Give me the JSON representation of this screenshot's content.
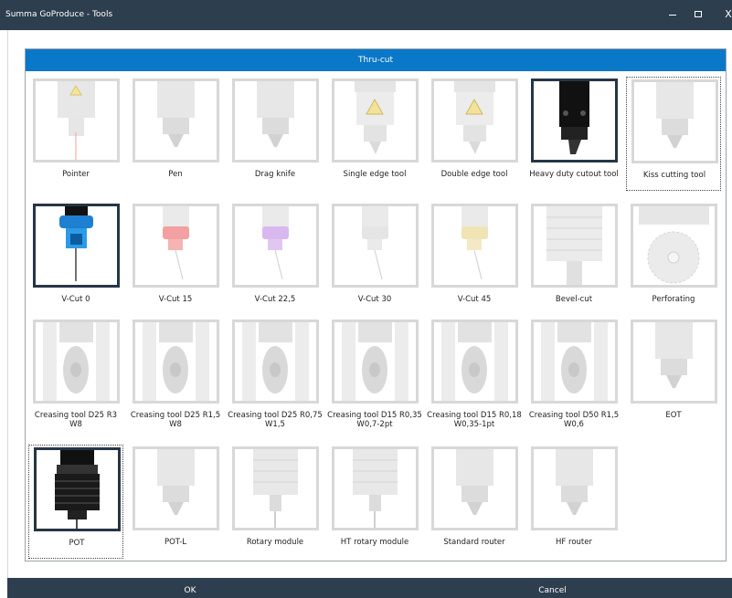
{
  "window": {
    "title": "Summa GoProduce - Tools",
    "minimize_glyph": "–",
    "maximize_glyph": "□",
    "close_glyph": "X"
  },
  "panel": {
    "header": "Thru-cut"
  },
  "tools": [
    {
      "label": "Pointer",
      "icon": "pointer-icon",
      "state": "normal"
    },
    {
      "label": "Pen",
      "icon": "pen-icon",
      "state": "normal"
    },
    {
      "label": "Drag knife",
      "icon": "drag-knife-icon",
      "state": "normal"
    },
    {
      "label": "Single edge tool",
      "icon": "single-edge-tool-icon",
      "state": "normal"
    },
    {
      "label": "Double edge tool",
      "icon": "double-edge-tool-icon",
      "state": "normal"
    },
    {
      "label": "Heavy duty cutout tool",
      "icon": "heavy-duty-cutout-tool-icon",
      "state": "active"
    },
    {
      "label": "Kiss cutting tool",
      "icon": "kiss-cutting-tool-icon",
      "state": "selected"
    },
    {
      "label": "V-Cut 0",
      "icon": "v-cut-0-icon",
      "state": "active"
    },
    {
      "label": "V-Cut 15",
      "icon": "v-cut-15-icon",
      "state": "normal"
    },
    {
      "label": "V-Cut 22,5",
      "icon": "v-cut-22-5-icon",
      "state": "normal"
    },
    {
      "label": "V-Cut 30",
      "icon": "v-cut-30-icon",
      "state": "normal"
    },
    {
      "label": "V-Cut 45",
      "icon": "v-cut-45-icon",
      "state": "normal"
    },
    {
      "label": "Bevel-cut",
      "icon": "bevel-cut-icon",
      "state": "normal"
    },
    {
      "label": "Perforating",
      "icon": "perforating-icon",
      "state": "normal"
    },
    {
      "label": "Creasing tool D25 R3 W8",
      "icon": "creasing-tool-icon",
      "state": "normal"
    },
    {
      "label": "Creasing tool D25 R1,5 W8",
      "icon": "creasing-tool-icon",
      "state": "normal"
    },
    {
      "label": "Creasing tool D25 R0,75 W1,5",
      "icon": "creasing-tool-icon",
      "state": "normal"
    },
    {
      "label": "Creasing tool D15 R0,35 W0,7-2pt",
      "icon": "creasing-tool-icon",
      "state": "normal"
    },
    {
      "label": "Creasing tool D15 R0,18 W0,35-1pt",
      "icon": "creasing-tool-icon",
      "state": "normal"
    },
    {
      "label": "Creasing tool D50 R1,5 W0,6",
      "icon": "creasing-tool-icon",
      "state": "normal"
    },
    {
      "label": "EOT",
      "icon": "eot-icon",
      "state": "normal"
    },
    {
      "label": "POT",
      "icon": "pot-icon",
      "state": "active-selected"
    },
    {
      "label": "POT-L",
      "icon": "pot-l-icon",
      "state": "normal"
    },
    {
      "label": "Rotary module",
      "icon": "rotary-module-icon",
      "state": "normal"
    },
    {
      "label": "HT rotary module",
      "icon": "ht-rotary-module-icon",
      "state": "normal"
    },
    {
      "label": "Standard router",
      "icon": "standard-router-icon",
      "state": "normal"
    },
    {
      "label": "HF router",
      "icon": "hf-router-icon",
      "state": "normal"
    }
  ],
  "footer": {
    "ok_label": "OK",
    "cancel_label": "Cancel"
  },
  "colors": {
    "titlebar": "#2d3e4e",
    "header": "#0a78c8",
    "active_border": "#263645",
    "inactive_border": "#d8d8d8"
  }
}
